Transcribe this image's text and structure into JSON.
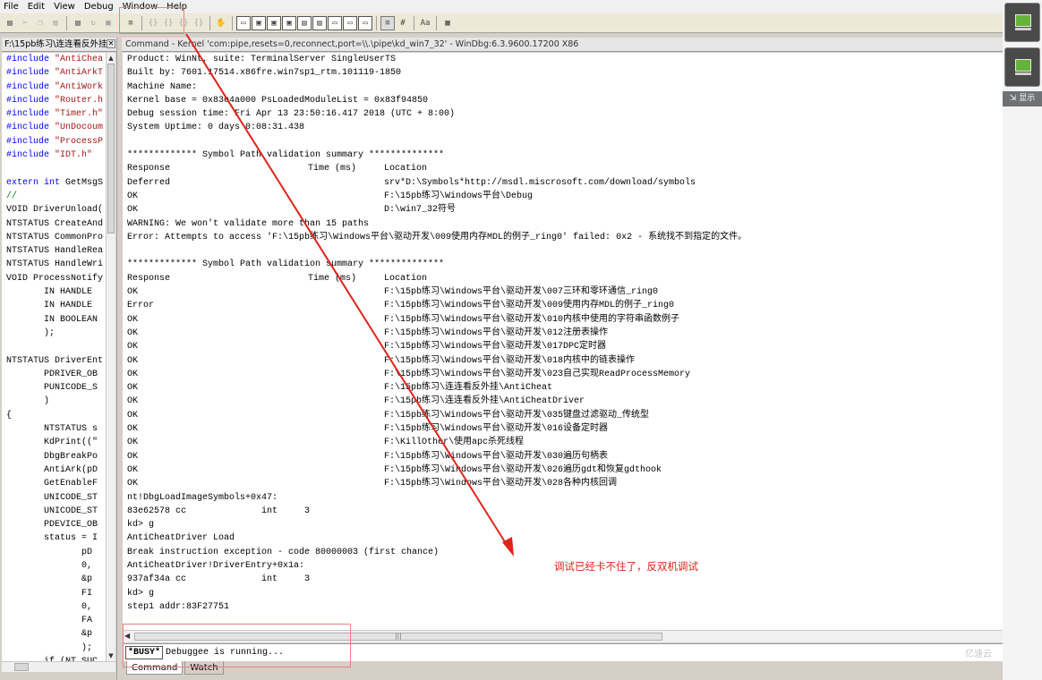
{
  "menu": [
    "File",
    "Edit",
    "View",
    "Debug",
    "Window",
    "Help"
  ],
  "toolbar_icons": [
    "open-icon",
    "cut-icon",
    "copy-icon",
    "paste-icon",
    "sep",
    "go-icon",
    "restart-icon",
    "stop-icon",
    "sep",
    "break-icon",
    "sep",
    "step-into-icon",
    "step-over-icon",
    "step-out-icon",
    "run-to-cursor-icon",
    "sep",
    "hand-icon",
    "sep",
    "command-window-icon",
    "watch-window-icon",
    "locals-window-icon",
    "registers-window-icon",
    "memory-window-icon",
    "callstack-window-icon",
    "disassembly-window-icon",
    "scratch-pad-icon",
    "processes-threads-icon",
    "sep",
    "source-mode-icon",
    "hex-mode-icon",
    "sep",
    "font-icon",
    "sep",
    "options-icon"
  ],
  "source_tab": {
    "title": "F:\\15pb练习\\连连看反外挂"
  },
  "command_tab": {
    "title": "Command - Kernel 'com:pipe,resets=0,reconnect,port=\\\\.\\pipe\\kd_win7_32' - WinDbg:6.3.9600.17200 X86"
  },
  "source_lines": [
    {
      "t": "#include \"AntiChea",
      "c": "inc"
    },
    {
      "t": "#include \"AntiArkT",
      "c": "inc"
    },
    {
      "t": "#include \"AntiWork",
      "c": "inc"
    },
    {
      "t": "#include \"Router.h",
      "c": "inc"
    },
    {
      "t": "#include \"Timer.h\"",
      "c": "inc"
    },
    {
      "t": "#include \"UnDocoum",
      "c": "inc"
    },
    {
      "t": "#include \"ProcessP",
      "c": "inc"
    },
    {
      "t": "#include \"IDT.h\"",
      "c": "inc"
    },
    {
      "t": "",
      "c": ""
    },
    {
      "t": "extern int GetMsgS",
      "c": "ext"
    },
    {
      "t": "//",
      "c": "cmt"
    },
    {
      "t": "VOID DriverUnload(",
      "c": ""
    },
    {
      "t": "NTSTATUS CreateAnd",
      "c": ""
    },
    {
      "t": "NTSTATUS CommonPro",
      "c": ""
    },
    {
      "t": "NTSTATUS HandleRea",
      "c": ""
    },
    {
      "t": "NTSTATUS HandleWri",
      "c": ""
    },
    {
      "t": "VOID ProcessNotify",
      "c": ""
    },
    {
      "t": "       IN HANDLE",
      "c": ""
    },
    {
      "t": "       IN HANDLE",
      "c": ""
    },
    {
      "t": "       IN BOOLEAN",
      "c": ""
    },
    {
      "t": "       );",
      "c": ""
    },
    {
      "t": "",
      "c": ""
    },
    {
      "t": "NTSTATUS DriverEnt",
      "c": ""
    },
    {
      "t": "       PDRIVER_OB",
      "c": ""
    },
    {
      "t": "       PUNICODE_S",
      "c": ""
    },
    {
      "t": "       )",
      "c": ""
    },
    {
      "t": "{",
      "c": ""
    },
    {
      "t": "       NTSTATUS s",
      "c": ""
    },
    {
      "t": "       KdPrint((\"",
      "c": ""
    },
    {
      "t": "       DbgBreakPo",
      "c": ""
    },
    {
      "t": "       AntiArk(pD",
      "c": ""
    },
    {
      "t": "       GetEnableF",
      "c": ""
    },
    {
      "t": "       UNICODE_ST",
      "c": ""
    },
    {
      "t": "       UNICODE_ST",
      "c": ""
    },
    {
      "t": "       PDEVICE_OB",
      "c": ""
    },
    {
      "t": "       status = I",
      "c": ""
    },
    {
      "t": "              pD",
      "c": ""
    },
    {
      "t": "              0,",
      "c": ""
    },
    {
      "t": "              &p",
      "c": ""
    },
    {
      "t": "              FI",
      "c": ""
    },
    {
      "t": "              0,",
      "c": ""
    },
    {
      "t": "              FA",
      "c": ""
    },
    {
      "t": "              &p",
      "c": ""
    },
    {
      "t": "              );",
      "c": ""
    },
    {
      "t": "       if (NT_SUC",
      "c": ""
    }
  ],
  "output_lines": [
    [
      "Product: WinNt, suite: TerminalServer SingleUserTS"
    ],
    [
      "Built by: 7601.17514.x86fre.win7sp1_rtm.101119-1850"
    ],
    [
      "Machine Name:"
    ],
    [
      "Kernel base = 0x83e4a000 PsLoadedModuleList = 0x83f94850"
    ],
    [
      "Debug session time: Fri Apr 13 23:50:16.417 2018 (UTC + 8:00)"
    ],
    [
      "System Uptime: 0 days 0:08:31.438"
    ],
    [
      ""
    ],
    [
      "************* Symbol Path validation summary **************"
    ],
    [
      "Response",
      "Time (ms)",
      "Location"
    ],
    [
      "Deferred",
      "",
      "srv*D:\\Symbols*http://msdl.miscrosoft.com/download/symbols"
    ],
    [
      "OK",
      "",
      "F:\\15pb练习\\Windows平台\\Debug"
    ],
    [
      "OK",
      "",
      "D:\\win7_32符号"
    ],
    [
      "WARNING: We won't validate more than 15 paths"
    ],
    [
      "Error: Attempts to access 'F:\\15pb练习\\Windows平台\\驱动开发\\009使用内存MDL的例子_ring0' failed: 0x2 - 系统找不到指定的文件。"
    ],
    [
      ""
    ],
    [
      "************* Symbol Path validation summary **************"
    ],
    [
      "Response",
      "Time (ms)",
      "Location"
    ],
    [
      "OK",
      "",
      "F:\\15pb练习\\Windows平台\\驱动开发\\007三环和零环通信_ring0"
    ],
    [
      "Error",
      "",
      "F:\\15pb练习\\Windows平台\\驱动开发\\009使用内存MDL的例子_ring0"
    ],
    [
      "OK",
      "",
      "F:\\15pb练习\\Windows平台\\驱动开发\\010内核中使用的字符串函数例子"
    ],
    [
      "OK",
      "",
      "F:\\15pb练习\\Windows平台\\驱动开发\\012注册表操作"
    ],
    [
      "OK",
      "",
      "F:\\15pb练习\\Windows平台\\驱动开发\\017DPC定时器"
    ],
    [
      "OK",
      "",
      "F:\\15pb练习\\Windows平台\\驱动开发\\018内核中的链表操作"
    ],
    [
      "OK",
      "",
      "F:\\15pb练习\\Windows平台\\驱动开发\\023自己实现ReadProcessMemory"
    ],
    [
      "OK",
      "",
      "F:\\15pb练习\\连连看反外挂\\AntiCheat"
    ],
    [
      "OK",
      "",
      "F:\\15pb练习\\连连看反外挂\\AntiCheatDriver"
    ],
    [
      "OK",
      "",
      "F:\\15pb练习\\Windows平台\\驱动开发\\035键盘过滤驱动_传统型"
    ],
    [
      "OK",
      "",
      "F:\\15pb练习\\Windows平台\\驱动开发\\016设备定时器"
    ],
    [
      "OK",
      "",
      "F:\\KillOther\\使用apc杀死线程"
    ],
    [
      "OK",
      "",
      "F:\\15pb练习\\Windows平台\\驱动开发\\030遍历句柄表"
    ],
    [
      "OK",
      "",
      "F:\\15pb练习\\Windows平台\\驱动开发\\026遍历gdt和恢复gdthook"
    ],
    [
      "OK",
      "",
      "F:\\15pb练习\\Windows平台\\驱动开发\\028各种内核回调"
    ],
    [
      "nt!DbgLoadImageSymbols+0x47:"
    ],
    [
      "83e62578 cc              int     3"
    ],
    [
      "kd> g"
    ],
    [
      "AntiCheatDriver Load"
    ],
    [
      "Break instruction exception - code 80000003 (first chance)"
    ],
    [
      "AntiCheatDriver!DriverEntry+0x1a:"
    ],
    [
      "937af34a cc              int     3"
    ],
    [
      "kd> g"
    ],
    [
      "step1 addr:83F27751"
    ]
  ],
  "command_input": {
    "prompt": "*BUSY*",
    "status": "Debuggee is running..."
  },
  "bottom_tabs": [
    "Command",
    "Watch"
  ],
  "annotation": "调试已经卡不住了，反双机调试",
  "sidebar": {
    "show_label": "显示"
  },
  "colors": {
    "annotation": "#e0241c",
    "vm_screen": "#66b33a"
  }
}
